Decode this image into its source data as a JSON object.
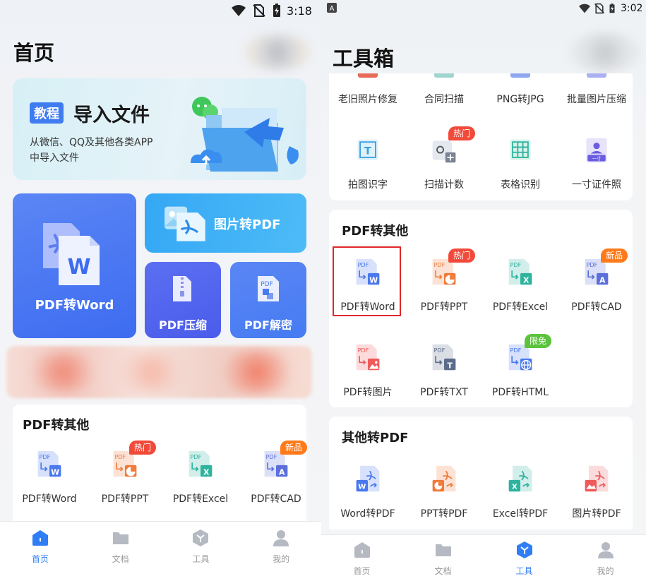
{
  "left": {
    "status": {
      "time": "3:18"
    },
    "title": "首页",
    "banner": {
      "tag": "教程",
      "heading": "导入文件",
      "desc_line1": "从微信、QQ及其他各类APP",
      "desc_line2": "中导入文件"
    },
    "features": {
      "pdf_to_word": "PDF转Word",
      "image_to_pdf": "图片转PDF",
      "compress": "PDF压缩",
      "decrypt": "PDF解密"
    },
    "section": {
      "title": "PDF转其他",
      "tools": [
        {
          "label": "PDF转Word",
          "icon": "pdf-to-word-icon"
        },
        {
          "label": "PDF转PPT",
          "icon": "pdf-to-ppt-icon",
          "badge": "热门"
        },
        {
          "label": "PDF转Excel",
          "icon": "pdf-to-excel-icon"
        },
        {
          "label": "PDF转CAD",
          "icon": "pdf-to-cad-icon",
          "badge": "新品"
        }
      ]
    },
    "tabs": [
      {
        "label": "首页",
        "icon": "home-icon",
        "active": true
      },
      {
        "label": "文档",
        "icon": "folder-icon",
        "active": false
      },
      {
        "label": "工具",
        "icon": "toolbox-icon",
        "active": false
      },
      {
        "label": "我的",
        "icon": "profile-icon",
        "active": false
      }
    ]
  },
  "right": {
    "status": {
      "time": "3:02"
    },
    "title": "工具箱",
    "image_tools_row1": [
      "老旧照片修复",
      "合同扫描",
      "PNG转JPG",
      "批量图片压缩"
    ],
    "image_tools_row2": [
      {
        "label": "拍图识字",
        "icon": "text-recognition-icon"
      },
      {
        "label": "扫描计数",
        "icon": "scan-count-icon",
        "badge": "热门"
      },
      {
        "label": "表格识别",
        "icon": "table-recognition-icon"
      },
      {
        "label": "一寸证件照",
        "icon": "id-photo-icon",
        "icon_text": "一寸"
      }
    ],
    "pdf_section": {
      "title": "PDF转其他",
      "tools": [
        {
          "label": "PDF转Word",
          "icon": "pdf-to-word-icon"
        },
        {
          "label": "PDF转PPT",
          "icon": "pdf-to-ppt-icon",
          "badge": "热门"
        },
        {
          "label": "PDF转Excel",
          "icon": "pdf-to-excel-icon"
        },
        {
          "label": "PDF转CAD",
          "icon": "pdf-to-cad-icon",
          "badge": "新品"
        },
        {
          "label": "PDF转图片",
          "icon": "pdf-to-image-icon"
        },
        {
          "label": "PDF转TXT",
          "icon": "pdf-to-txt-icon"
        },
        {
          "label": "PDF转HTML",
          "icon": "pdf-to-html-icon",
          "badge": "限免"
        }
      ]
    },
    "other_section": {
      "title": "其他转PDF",
      "tools": [
        {
          "label": "Word转PDF",
          "icon": "word-to-pdf-icon"
        },
        {
          "label": "PPT转PDF",
          "icon": "ppt-to-pdf-icon"
        },
        {
          "label": "Excel转PDF",
          "icon": "excel-to-pdf-icon"
        },
        {
          "label": "图片转PDF",
          "icon": "image-to-pdf-icon"
        }
      ]
    },
    "tabs": [
      {
        "label": "首页",
        "icon": "home-icon",
        "active": false
      },
      {
        "label": "文档",
        "icon": "folder-icon",
        "active": false
      },
      {
        "label": "工具",
        "icon": "toolbox-icon",
        "active": true
      },
      {
        "label": "我的",
        "icon": "profile-icon",
        "active": false
      }
    ]
  },
  "doc_label": "PDF",
  "colors": {
    "accent": "#2f7ef6",
    "word": "#4a78ee",
    "ppt": "#f07a3a",
    "excel": "#2db39e",
    "cad": "#5a6fdc",
    "image": "#ef5b5b",
    "txt": "#5c6b8a",
    "hot_badge": "#f24a3a",
    "new_badge": "#ff7a1a",
    "free_badge": "#5bc33c",
    "highlight_border": "#e0282a"
  }
}
